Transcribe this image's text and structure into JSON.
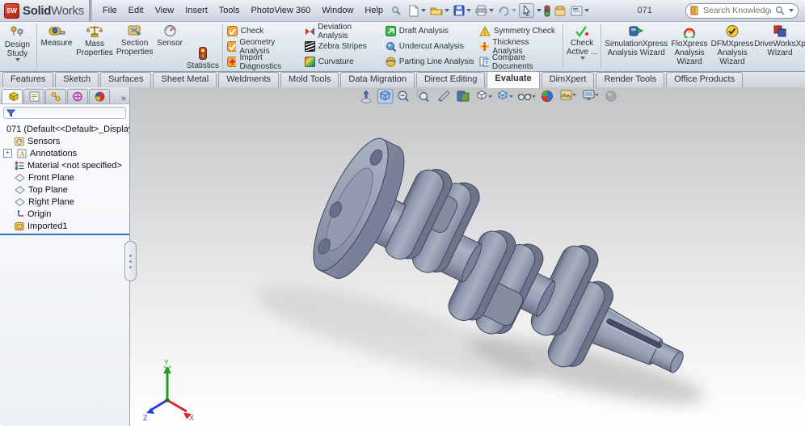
{
  "title_bar": {
    "logo": {
      "cube": "SW",
      "bold": "Solid",
      "light": "Works"
    },
    "menus": [
      "File",
      "Edit",
      "View",
      "Insert",
      "Tools",
      "PhotoView 360",
      "Window",
      "Help"
    ],
    "document_number": "071",
    "search_placeholder": "Search Knowledge Base"
  },
  "ribbon": {
    "design_study": "Design Study",
    "tools": [
      "Measure",
      "Mass Properties",
      "Section Properties",
      "Sensor",
      "Statistics"
    ],
    "analysis_col1": [
      "Check",
      "Geometry Analysis",
      "Import Diagnostics"
    ],
    "analysis_col2": [
      "Deviation Analysis",
      "Zebra Stripes",
      "Curvature"
    ],
    "analysis_col3": [
      "Draft Analysis",
      "Undercut Analysis",
      "Parting Line Analysis"
    ],
    "analysis_col4": [
      "Symmetry Check",
      "Thickness Analysis",
      "Compare Documents"
    ],
    "check_active": "Check Active ...",
    "wizards": [
      "SimulationXpress Analysis Wizard",
      "FloXpress Analysis Wizard",
      "DFMXpress Analysis Wizard",
      "DriveWorksXp Wizard"
    ]
  },
  "command_tabs": {
    "items": [
      "Features",
      "Sketch",
      "Surfaces",
      "Sheet Metal",
      "Weldments",
      "Mold Tools",
      "Data Migration",
      "Direct Editing",
      "Evaluate",
      "DimXpert",
      "Render Tools",
      "Office Products"
    ],
    "active": "Evaluate"
  },
  "feature_tree": {
    "panel_expand": "»",
    "root": "071 (Default<<Default>_Display",
    "items": [
      "Sensors",
      "Annotations",
      "Material <not specified>",
      "Front Plane",
      "Top Plane",
      "Right Plane",
      "Origin",
      "Imported1"
    ]
  },
  "viewport": {
    "triad": {
      "x_label": "X",
      "y_label": "Y",
      "z_label": "Z"
    }
  },
  "colors": {
    "model_body": "#99a1b5",
    "model_outline": "#3f455c",
    "selection_blue": "#3a6fc4",
    "triad_x": "#d42a2a",
    "triad_y": "#1f9e1f",
    "triad_z": "#2a3fd4",
    "accent_orange": "#e8a33d"
  }
}
